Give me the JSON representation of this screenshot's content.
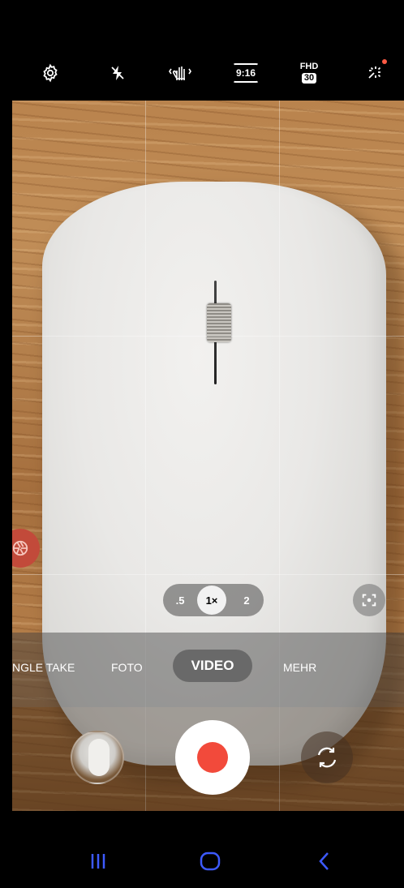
{
  "top_toolbar": {
    "icons": [
      "gear-icon",
      "flash-off-icon",
      "stabilizer-hand-icon",
      "aspect-ratio-icon",
      "resolution-fps-icon",
      "filter-effects-icon"
    ],
    "aspect_ratio": "9:16",
    "resolution": "FHD",
    "fps": "30"
  },
  "zoom": {
    "options": [
      ".5",
      "1×",
      "2"
    ],
    "active": "1×"
  },
  "modes": {
    "items": [
      "NGLE TAKE",
      "FOTO",
      "VIDEO",
      "MEHR"
    ],
    "active": "VIDEO"
  },
  "colors": {
    "record": "#f24a3b",
    "notification_dot": "#ff5a44",
    "nav_icons": "#3d5afe"
  }
}
